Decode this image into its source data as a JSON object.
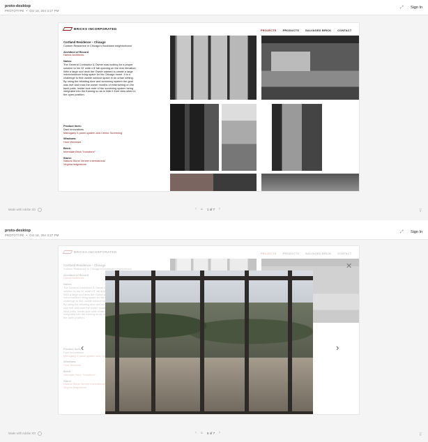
{
  "app": {
    "project_name": "proto-desktop",
    "meta_type": "PROTOTYPE",
    "meta_separator": "•",
    "meta_date": "Oct 18, 204 3:27 PM",
    "sign_in": "Sign In",
    "expand_icon": "expand-icon",
    "made_with": "Made with Adobe XD",
    "filter_icon": "filter-icon"
  },
  "site": {
    "logo_text": "BRICKS INCORPORATED",
    "nav": [
      "PROJECTS",
      "PRODUCTS",
      "SALVAGED BRICK",
      "CONTACT"
    ],
    "active_nav": "PROJECTS"
  },
  "project": {
    "title": "Cortland Residence – Chicago",
    "subtitle": "Custom Residence in Chicago's Bucktown neighborhood",
    "architect_label": "Architect of Record",
    "architect": "Hanna Architects",
    "notes_label": "Notes:",
    "notes": "The General Contractor & Owner was looking for a proper solution to his 10' wide x 8' tall opening on the rear elevation. With a large roof deck the Owner wanted to create a large indoor/outdoor living space for his Chicago home. It is a challenge to find usable outdoor space in an urban setting. By using the bifolding door and screening system the goal was met and rows the owner months of entertaining on the back patio. Inside-tuck note of the screening system being integrated into the framing so as to hide it from view when in the open position.",
    "product_label": "Product lines:",
    "product": "Dani Innovations",
    "product_link": "Mahogany 5 panel system and Centor Screening",
    "windows_label": "Windows:",
    "windows": "Hurd Windows",
    "brick_label": "Brick:",
    "brick": "Interstate Brick \"Ironstone\"",
    "stone_label": "Stone:",
    "stone_1": "Natural Stone Veneer International",
    "stone_2": "Virginia ledgestone"
  },
  "pager": {
    "top": "1 of 7",
    "bottom": "6 of 7"
  },
  "lightbox": {
    "close_icon": "close-icon",
    "prev_icon": "chevron-left-icon",
    "next_icon": "chevron-right-icon"
  }
}
